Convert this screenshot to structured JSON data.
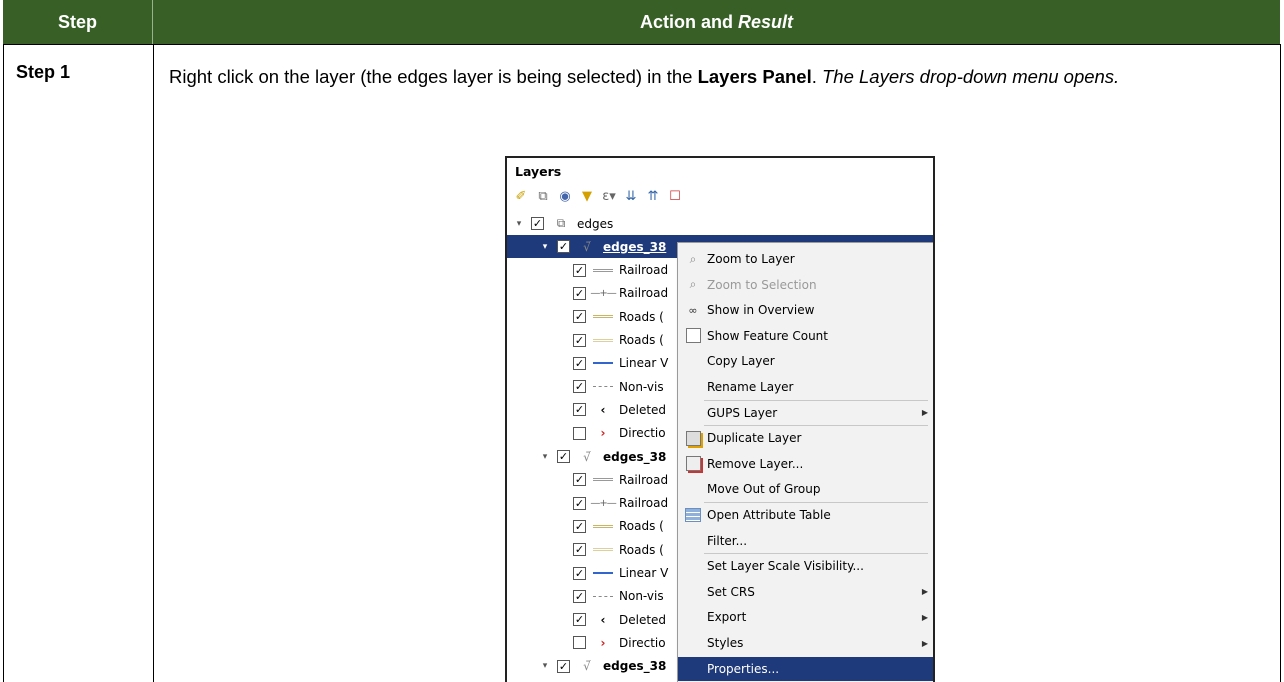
{
  "table": {
    "header_step": "Step",
    "header_action": "Action and",
    "header_result": "Result",
    "step_label": "Step 1",
    "text_pre": "Right click on the layer (the edges layer is being selected) in the ",
    "text_bold": "Layers Panel",
    "text_mid": ". ",
    "text_italic": "The Layers drop-down menu opens."
  },
  "qgis": {
    "panel_title": "Layers",
    "tree": [
      {
        "label": "edges",
        "checked": true,
        "expanded": true,
        "icon": "group-icon"
      },
      {
        "label": "edges_38",
        "checked": true,
        "expanded": true,
        "icon": "line-layer-icon",
        "selected": true
      },
      {
        "label": "Railroad",
        "checked": true,
        "icon": "railroad-symbol"
      },
      {
        "label": "Railroad",
        "checked": true,
        "icon": "railroad-cross-symbol"
      },
      {
        "label": "Roads (",
        "checked": true,
        "icon": "road-primary-symbol"
      },
      {
        "label": "Roads (",
        "checked": true,
        "icon": "road-secondary-symbol"
      },
      {
        "label": "Linear V",
        "checked": true,
        "icon": "linear-water-symbol"
      },
      {
        "label": "Non-vis",
        "checked": true,
        "icon": "non-visible-symbol"
      },
      {
        "label": "Deleted",
        "checked": true,
        "icon": "deleted-symbol"
      },
      {
        "label": "Directio",
        "checked": false,
        "icon": "direction-symbol"
      },
      {
        "label": "edges_38",
        "checked": true,
        "expanded": true,
        "icon": "line-layer-icon"
      },
      {
        "label": "Railroad",
        "checked": true,
        "icon": "railroad-symbol"
      },
      {
        "label": "Railroad",
        "checked": true,
        "icon": "railroad-cross-symbol"
      },
      {
        "label": "Roads (",
        "checked": true,
        "icon": "road-primary-symbol"
      },
      {
        "label": "Roads (",
        "checked": true,
        "icon": "road-secondary-symbol"
      },
      {
        "label": "Linear V",
        "checked": true,
        "icon": "linear-water-symbol"
      },
      {
        "label": "Non-vis",
        "checked": true,
        "icon": "non-visible-symbol"
      },
      {
        "label": "Deleted",
        "checked": true,
        "icon": "deleted-symbol"
      },
      {
        "label": "Directio",
        "checked": false,
        "icon": "direction-symbol"
      },
      {
        "label": "edges_38",
        "checked": true,
        "expanded": true,
        "icon": "line-layer-icon"
      }
    ],
    "menu": [
      {
        "label": "Zoom to Layer",
        "icon": "zoom-icon"
      },
      {
        "label": "Zoom to Selection",
        "icon": "zoom-icon",
        "disabled": true
      },
      {
        "label": "Show in Overview",
        "icon": "overview-icon"
      },
      {
        "label": "Show Feature Count",
        "icon": "checkbox"
      },
      {
        "label": "Copy Layer"
      },
      {
        "label": "Rename Layer"
      },
      {
        "label": "GUPS Layer",
        "submenu": true
      },
      {
        "label": "Duplicate Layer",
        "icon": "duplicate-icon"
      },
      {
        "label": "Remove Layer...",
        "icon": "remove-icon"
      },
      {
        "label": "Move Out of Group"
      },
      {
        "label": "Open Attribute Table",
        "icon": "table-icon"
      },
      {
        "label": "Filter..."
      },
      {
        "label": "Set Layer Scale Visibility..."
      },
      {
        "label": "Set CRS",
        "submenu": true
      },
      {
        "label": "Export",
        "submenu": true
      },
      {
        "label": "Styles",
        "submenu": true
      },
      {
        "label": "Properties...",
        "selected": true
      }
    ]
  },
  "colors": {
    "header_bg": "#386026",
    "selection": "#1f3a7a"
  }
}
